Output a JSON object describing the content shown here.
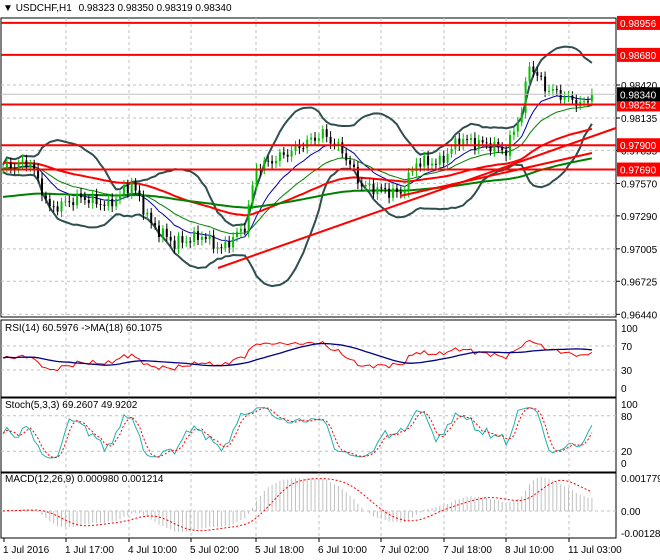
{
  "header": {
    "symbol": "USDCHF,H1",
    "ohlc": "0.98323 0.98350 0.98319 0.98340"
  },
  "main_axis": {
    "ticks": [
      "0.98420",
      "0.98135",
      "0.97855",
      "0.97570",
      "0.97290",
      "0.97005",
      "0.96725",
      "0.96440"
    ]
  },
  "levels": [
    {
      "price": 0.98956,
      "label": "0.98956"
    },
    {
      "price": 0.9868,
      "label": "0.98680"
    },
    {
      "price": 0.98252,
      "label": "0.98252"
    },
    {
      "price": 0.979,
      "label": "0.97900"
    },
    {
      "price": 0.9769,
      "label": "0.97690"
    }
  ],
  "current_price": {
    "price": 0.9834,
    "label": "0.98340"
  },
  "rsi": {
    "title": "RSI(14) 60.5976  ->MA(18) 60.1075",
    "ticks": [
      "100",
      "70",
      "30",
      "0"
    ]
  },
  "stoch": {
    "title": "Stoch(5,3,3) 69.2607 49.9202",
    "ticks": [
      "100",
      "80",
      "20",
      "0"
    ]
  },
  "macd": {
    "title": "MACD(12,26,9) 0.000980 0.001214",
    "ticks": [
      "0.001779",
      "0.00",
      "-0.001285"
    ]
  },
  "time_axis": [
    "1 Jul 2016",
    "1 Jul 17:00",
    "4 Jul 10:00",
    "5 Jul 02:00",
    "5 Jul 18:00",
    "6 Jul 10:00",
    "7 Jul 02:00",
    "7 Jul 18:00",
    "8 Jul 10:00",
    "11 Jul 03:00"
  ],
  "colors": {
    "level": "#ff0000",
    "bands": "#2f4f4f",
    "ma_slow": "#ff0000",
    "ma_long": "#008000",
    "bull": "#00c000",
    "bear": "#000000",
    "rsi": "#ff0000",
    "rsi_ma": "#000080",
    "stoch_main": "#20b2aa",
    "stoch_signal": "#ff0000",
    "macd_hist": "#c0c0c0"
  },
  "chart_data": {
    "type": "candlestick",
    "title": "USDCHF,H1",
    "bars": 152,
    "ylim": [
      0.9644,
      0.9896
    ],
    "close_waypoints": [
      [
        0,
        0.977
      ],
      [
        7,
        0.9775
      ],
      [
        12,
        0.9735
      ],
      [
        20,
        0.9745
      ],
      [
        27,
        0.9738
      ],
      [
        33,
        0.9757
      ],
      [
        38,
        0.9722
      ],
      [
        44,
        0.9705
      ],
      [
        51,
        0.9712
      ],
      [
        56,
        0.97
      ],
      [
        62,
        0.972
      ],
      [
        65,
        0.977
      ],
      [
        74,
        0.9785
      ],
      [
        82,
        0.98
      ],
      [
        87,
        0.9785
      ],
      [
        92,
        0.9755
      ],
      [
        102,
        0.9748
      ],
      [
        106,
        0.9775
      ],
      [
        112,
        0.9775
      ],
      [
        117,
        0.9795
      ],
      [
        125,
        0.979
      ],
      [
        129,
        0.9785
      ],
      [
        133,
        0.982
      ],
      [
        135,
        0.986
      ],
      [
        139,
        0.984
      ],
      [
        145,
        0.983
      ],
      [
        149,
        0.9825
      ],
      [
        151,
        0.9834
      ]
    ]
  }
}
